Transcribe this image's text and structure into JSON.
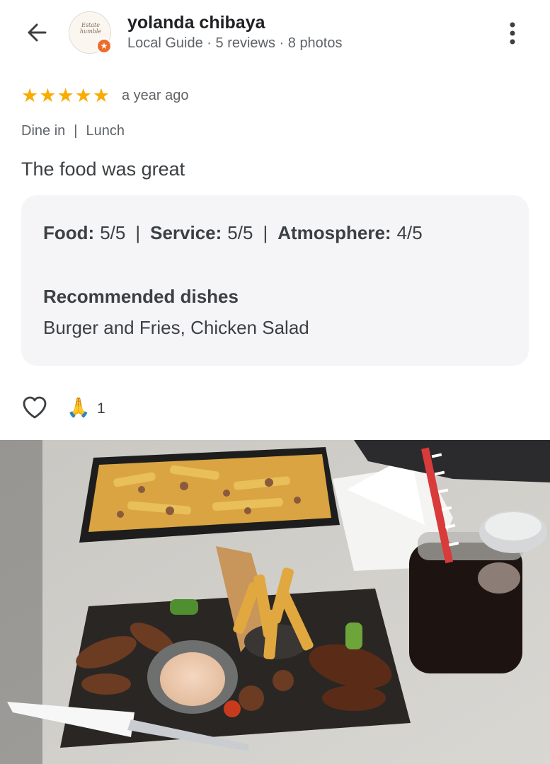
{
  "header": {
    "name": "yolanda chibaya",
    "meta": "Local Guide · 5 reviews · 8 photos",
    "avatar_text": "Estate humble",
    "badge_icon": "star-badge-icon"
  },
  "review": {
    "rating": 5,
    "max_rating": 5,
    "stars": [
      "★",
      "★",
      "★",
      "★",
      "★"
    ],
    "time": "a year ago",
    "dine_mode": "Dine in",
    "divider": "|",
    "meal": "Lunch",
    "text": "The food was great"
  },
  "ratings": {
    "food_label": "Food:",
    "food_value": "5/5",
    "service_label": "Service:",
    "service_value": "5/5",
    "atmosphere_label": "Atmosphere:",
    "atmosphere_value": "4/5",
    "sep": "|"
  },
  "recommended": {
    "title": "Recommended dishes",
    "dishes": "Burger and Fries, Chicken Salad"
  },
  "reactions": {
    "pray_emoji": "🙏",
    "count": "1"
  },
  "colors": {
    "star": "#f9ab00",
    "card_bg": "#f5f5f7",
    "text_primary": "#202124",
    "text_secondary": "#5f6368"
  }
}
